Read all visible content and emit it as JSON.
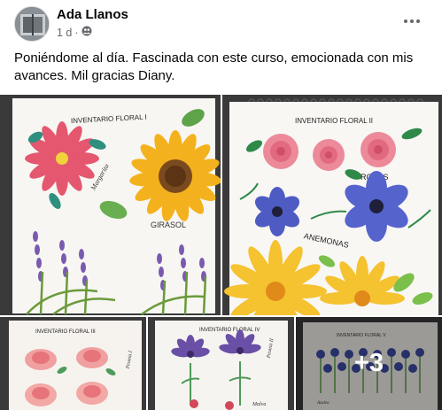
{
  "post": {
    "author": "Ada Llanos",
    "time": "1 d",
    "separator": "·",
    "privacy_icon": "friends-icon",
    "more_icon": "more-horizontal-icon",
    "text": "Poniéndome al día. Fascinada con este curso, emocionada con mis avances. Mil gracias Diany."
  },
  "photos": [
    {
      "title": "INVENTARIO FLORAL I",
      "labels": [
        "Margarita",
        "GIRASOL"
      ]
    },
    {
      "title": "INVENTARIO FLORAL II",
      "labels": [
        "ROSAS",
        "ANEMONAS"
      ]
    },
    {
      "title": "INVENTARIO FLORAL III",
      "labels": [
        "Peonia I"
      ]
    },
    {
      "title": "INVENTARIO FLORAL IV",
      "labels": [
        "Peonia II",
        "Malva"
      ]
    },
    {
      "title": "INVENTARIO FLORAL V",
      "labels": [
        "Azalea"
      ],
      "more_count": "+3"
    }
  ]
}
